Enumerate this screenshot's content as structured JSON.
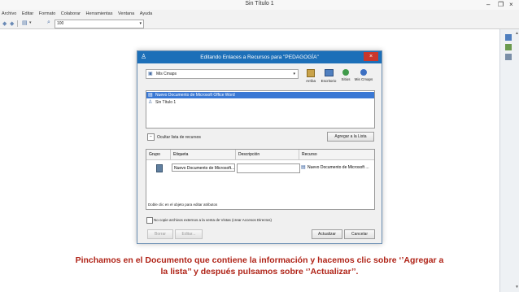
{
  "window": {
    "title": "Sin Título 1",
    "minimize": "–",
    "maximize": "❐",
    "close": "×"
  },
  "menu": [
    "Archivo",
    "Editar",
    "Formato",
    "Colaborar",
    "Herramientas",
    "Ventana",
    "Ayuda"
  ],
  "toolbar": {
    "zoom_value": "100"
  },
  "dialog": {
    "title": "Editando Enlaces a Recursos para \"PEDAGOGÍA\"",
    "close_label": "×",
    "location_select": "Mis Cmaps",
    "places": [
      "Arriba",
      "Escritorio",
      "Sitios",
      "Mis Cmaps"
    ],
    "files": [
      {
        "name": "Nuevo Documento de Microsoft Office Word",
        "selected": true
      },
      {
        "name": "Sin Título 1",
        "selected": false
      }
    ],
    "hide_list_label": "Ocultar lista de recursos",
    "add_button": "Agregar a la Lista",
    "table": {
      "headers": [
        "Grupo",
        "Etiqueta",
        "Descripción",
        "Recurso"
      ],
      "rows": [
        {
          "label": "Nuevo Documento de Microsoft...",
          "description": "",
          "resource": "Nuevo Documento de Microsoft ..."
        }
      ]
    },
    "hint": "Doble clic en el objeto para editar atributos",
    "checkbox_label": "No copie archivos externos a la venta de Vistas (crear Accesos Directos)",
    "buttons": {
      "delete": "Borrar",
      "edit": "Editar...",
      "update": "Actualizar",
      "cancel": "Cancelar"
    }
  },
  "caption": {
    "line1": "Pinchamos en el Documento que contiene la información y hacemos clic sobre ‘’Agregar a",
    "line2": "la lista’’ y después pulsamos sobre ‘’Actualizar’’."
  },
  "colors": {
    "titlebar_blue": "#1c6fb8",
    "selection": "#3a78d4",
    "caption_red": "#b02418",
    "close_red": "#c9372c"
  }
}
